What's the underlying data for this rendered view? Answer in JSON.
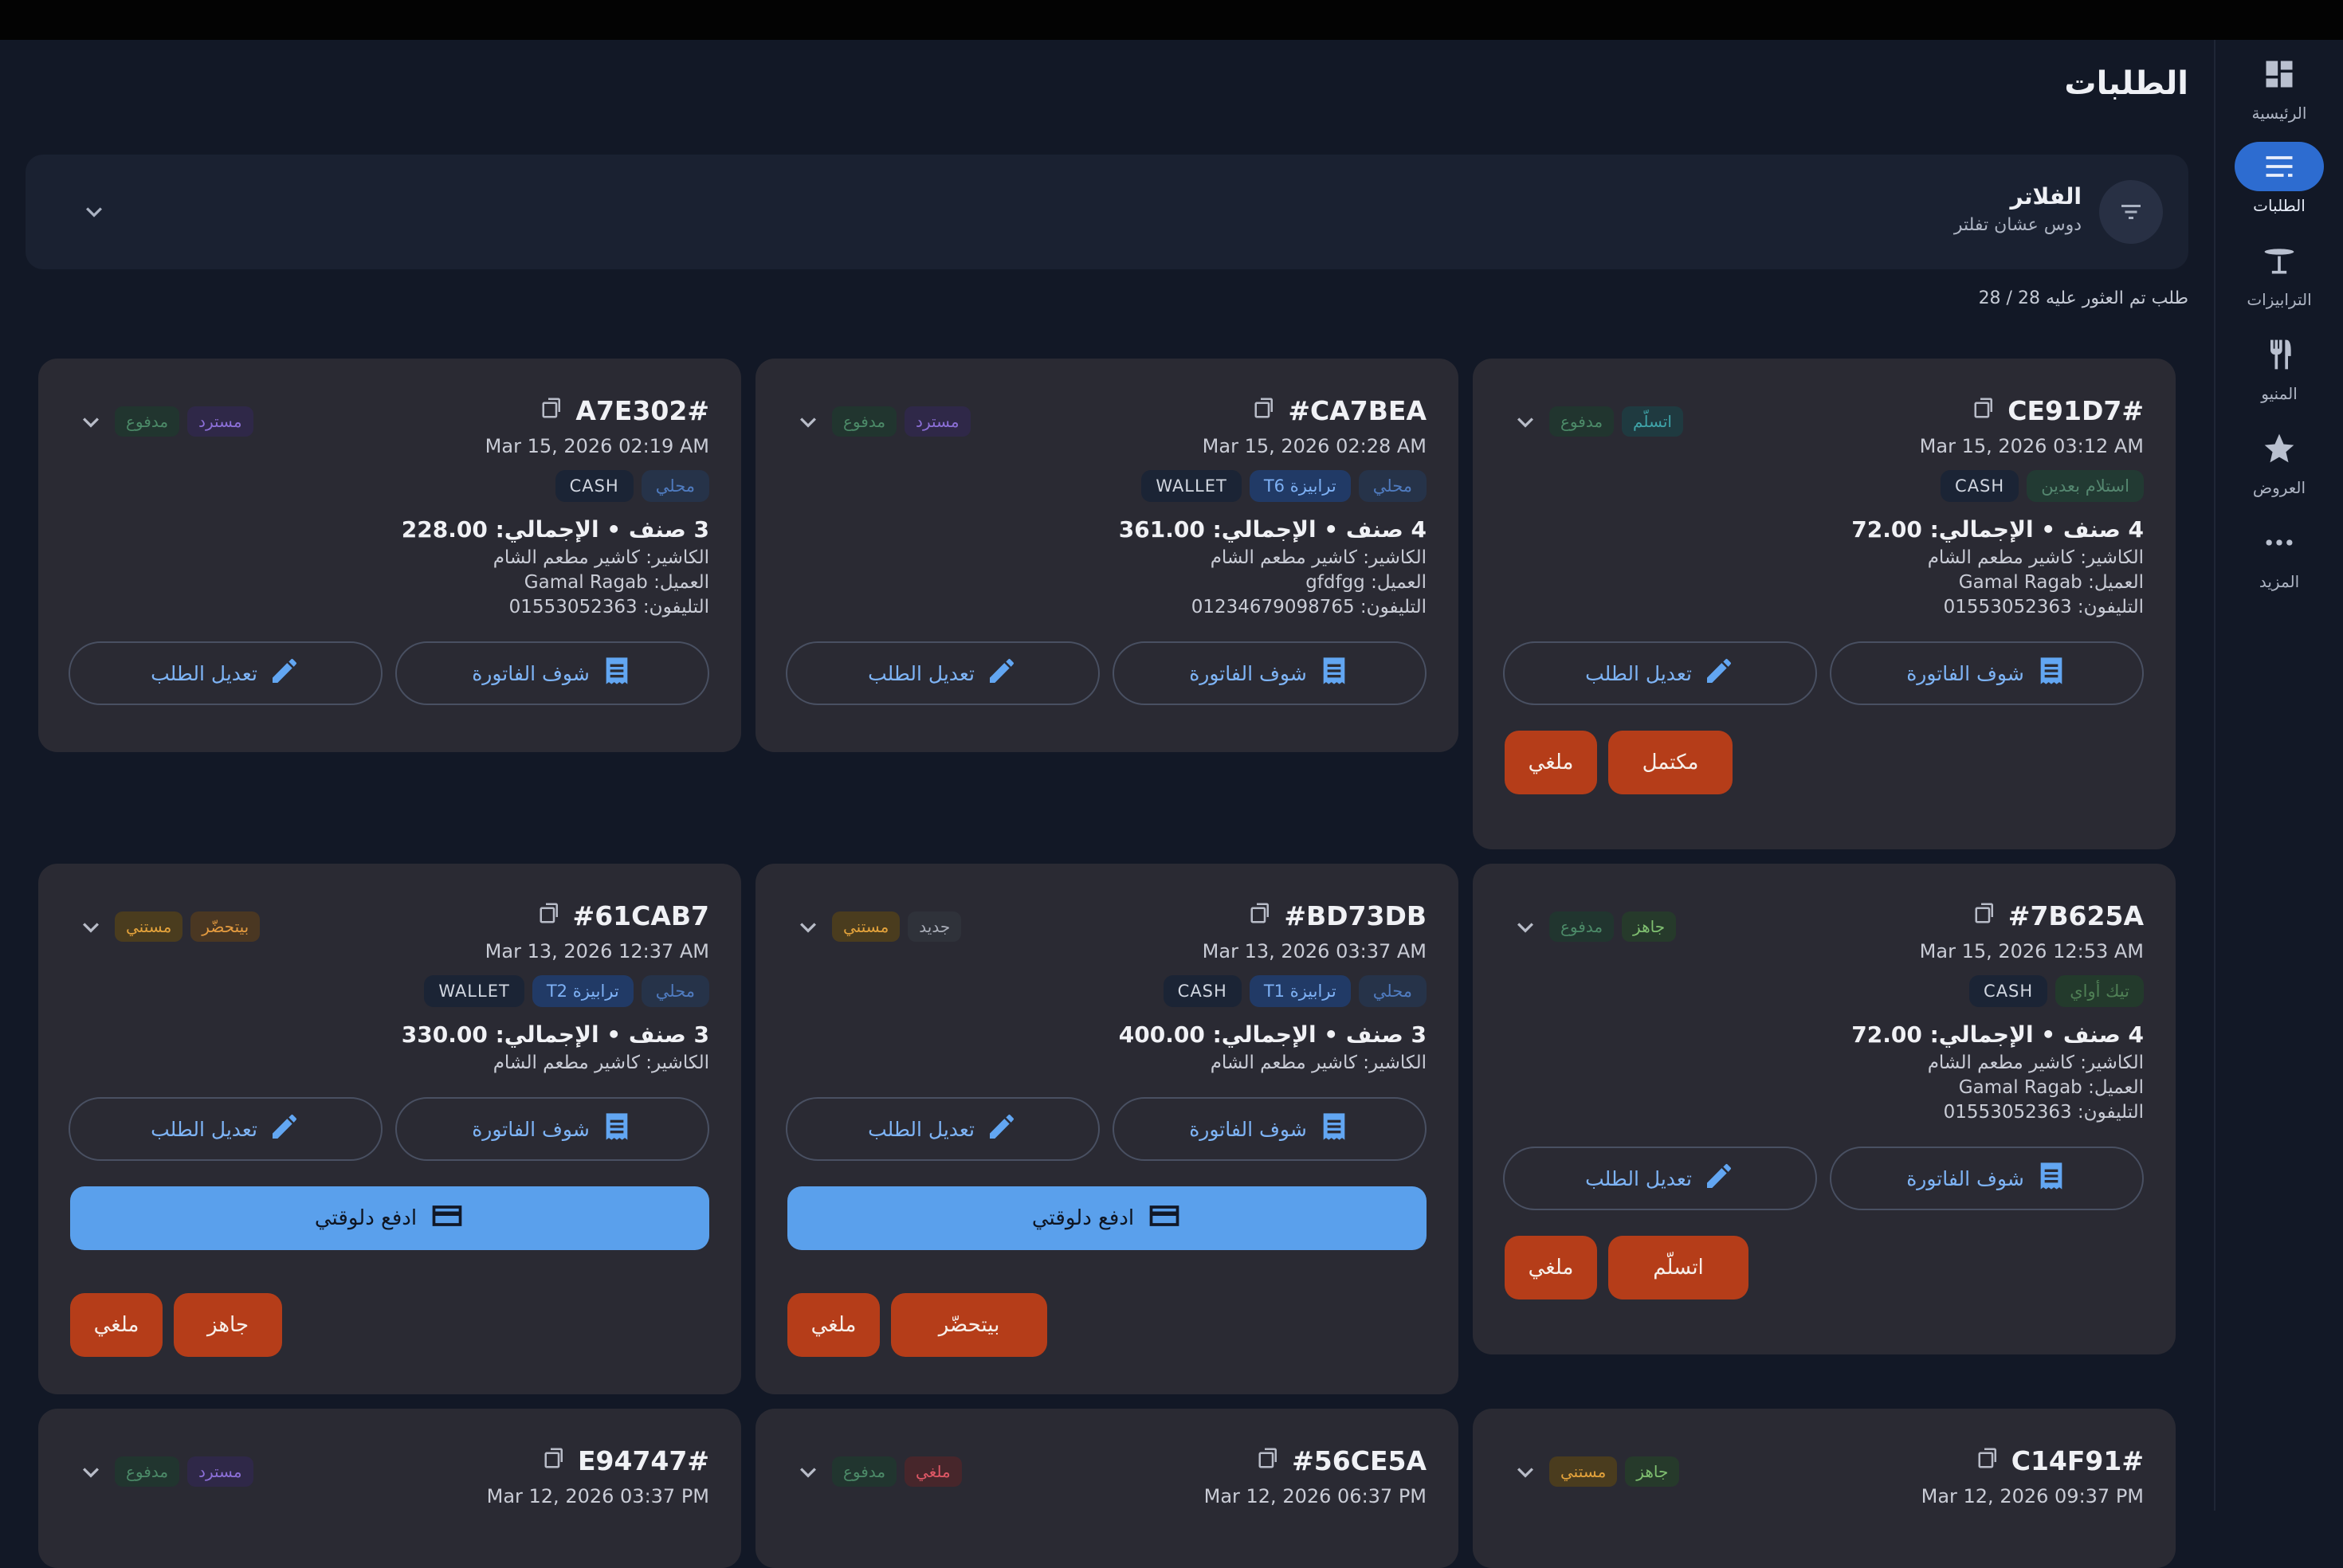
{
  "page": {
    "title": "الطلبات",
    "count_text": "28 / 28 طلب تم العثور عليه"
  },
  "filters": {
    "title": "الفلاتر",
    "subtitle": "دوس عشان تفلتر"
  },
  "rail": [
    {
      "label": "الرئيسية",
      "icon": "dashboard-icon",
      "active": false
    },
    {
      "label": "الطلبات",
      "icon": "orders-list-icon",
      "active": true
    },
    {
      "label": "الترابيزات",
      "icon": "table-icon",
      "active": false
    },
    {
      "label": "المنيو",
      "icon": "menu-utensils-icon",
      "active": false
    },
    {
      "label": "العروض",
      "icon": "star-icon",
      "active": false
    },
    {
      "label": "المزيد",
      "icon": "more-dots-icon",
      "active": false
    }
  ],
  "labels": {
    "view_invoice": "شوف الفاتورة",
    "edit_order": "تعديل الطلب",
    "pay_now": "ادفع دلوقتي"
  },
  "status_colors": {
    "paid": {
      "bg": "#21352f",
      "fg": "#4c8a68"
    },
    "refunded": {
      "bg": "#2f2848",
      "fg": "#8b6fd6"
    },
    "received": {
      "bg": "#1f3a40",
      "fg": "#3fa3a8"
    },
    "ready": {
      "bg": "#263a2b",
      "fg": "#7fbf70"
    },
    "preparing": {
      "bg": "#4a3722",
      "fg": "#e39a3f"
    },
    "waiting": {
      "bg": "#4a3c1e",
      "fg": "#e3a23b"
    },
    "new": {
      "bg": "#2f323a",
      "fg": "#a9adb8"
    },
    "cancelled": {
      "bg": "#47262b",
      "fg": "#e05866"
    }
  },
  "orders": [
    {
      "id": "CE91D7#",
      "date": "Mar 15, 2026 03:12 AM",
      "statuses": [
        {
          "text": "اتسلّم",
          "kind": "received"
        },
        {
          "text": "مدفوع",
          "kind": "paid"
        }
      ],
      "tags": [
        {
          "text": "استلام بعدين",
          "kind": "pickup"
        },
        {
          "text": "CASH",
          "kind": "pay"
        }
      ],
      "total_line": "4 صنف • الإجمالي: 72.00",
      "lines": [
        "الكاشير: كاشير مطعم الشام",
        "العميل: Gamal Ragab",
        "التليفون: 01553052363"
      ],
      "pay_button": false,
      "actions": [
        "مكتمل",
        "ملغي"
      ]
    },
    {
      "id": "CA7BEA#",
      "date": "Mar 15, 2026 02:28 AM",
      "statuses": [
        {
          "text": "مسترد",
          "kind": "refunded"
        },
        {
          "text": "مدفوع",
          "kind": "paid"
        }
      ],
      "tags": [
        {
          "text": "محلي",
          "kind": "local"
        },
        {
          "text": "ترابيزة T6",
          "kind": "table"
        },
        {
          "text": "WALLET",
          "kind": "pay"
        }
      ],
      "total_line": "4 صنف • الإجمالي: 361.00",
      "lines": [
        "الكاشير: كاشير مطعم الشام",
        "العميل: gfdfgg",
        "التليفون: 01234679098765"
      ],
      "pay_button": false,
      "actions": []
    },
    {
      "id": "A7E302#",
      "date": "Mar 15, 2026 02:19 AM",
      "statuses": [
        {
          "text": "مسترد",
          "kind": "refunded"
        },
        {
          "text": "مدفوع",
          "kind": "paid"
        }
      ],
      "tags": [
        {
          "text": "محلي",
          "kind": "local"
        },
        {
          "text": "CASH",
          "kind": "pay"
        }
      ],
      "total_line": "3 صنف • الإجمالي: 228.00",
      "lines": [
        "الكاشير: كاشير مطعم الشام",
        "العميل: Gamal Ragab",
        "التليفون: 01553052363"
      ],
      "pay_button": false,
      "actions": []
    },
    {
      "id": "#7B625A",
      "date": "Mar 15, 2026 12:53 AM",
      "statuses": [
        {
          "text": "جاهز",
          "kind": "ready"
        },
        {
          "text": "مدفوع",
          "kind": "paid"
        }
      ],
      "tags": [
        {
          "text": "تيك أواي",
          "kind": "takeaway"
        },
        {
          "text": "CASH",
          "kind": "pay"
        }
      ],
      "total_line": "4 صنف • الإجمالي: 72.00",
      "lines": [
        "الكاشير: كاشير مطعم الشام",
        "العميل: Gamal Ragab",
        "التليفون: 01553052363"
      ],
      "pay_button": false,
      "actions": [
        "اتسلّم",
        "ملغي"
      ]
    },
    {
      "id": "BD73DB#",
      "date": "Mar 13, 2026 03:37 AM",
      "statuses": [
        {
          "text": "جديد",
          "kind": "new"
        },
        {
          "text": "مستني",
          "kind": "waiting"
        }
      ],
      "tags": [
        {
          "text": "محلي",
          "kind": "local"
        },
        {
          "text": "ترابيزة T1",
          "kind": "table"
        },
        {
          "text": "CASH",
          "kind": "pay"
        }
      ],
      "total_line": "3 صنف • الإجمالي: 400.00",
      "lines": [
        "الكاشير: كاشير مطعم الشام"
      ],
      "pay_button": true,
      "actions": [
        "بيتحضّر",
        "ملغي"
      ]
    },
    {
      "id": "#61CAB7",
      "date": "Mar 13, 2026 12:37 AM",
      "statuses": [
        {
          "text": "بيتحضّر",
          "kind": "preparing"
        },
        {
          "text": "مستني",
          "kind": "waiting"
        }
      ],
      "tags": [
        {
          "text": "محلي",
          "kind": "local"
        },
        {
          "text": "ترابيزة T2",
          "kind": "table"
        },
        {
          "text": "WALLET",
          "kind": "pay"
        }
      ],
      "total_line": "3 صنف • الإجمالي: 330.00",
      "lines": [
        "الكاشير: كاشير مطعم الشام"
      ],
      "pay_button": true,
      "actions": [
        "جاهز",
        "ملغي"
      ]
    },
    {
      "id": "C14F91#",
      "date": "Mar 12, 2026 09:37 PM",
      "statuses": [
        {
          "text": "جاهز",
          "kind": "ready"
        },
        {
          "text": "مستني",
          "kind": "waiting"
        }
      ]
    },
    {
      "id": "#56CE5A",
      "date": "Mar 12, 2026 06:37 PM",
      "statuses": [
        {
          "text": "ملغي",
          "kind": "cancelled"
        },
        {
          "text": "مدفوع",
          "kind": "paid"
        }
      ]
    },
    {
      "id": "E94747#",
      "date": "Mar 12, 2026 03:37 PM",
      "statuses": [
        {
          "text": "مسترد",
          "kind": "refunded"
        },
        {
          "text": "مدفوع",
          "kind": "paid"
        }
      ]
    }
  ]
}
